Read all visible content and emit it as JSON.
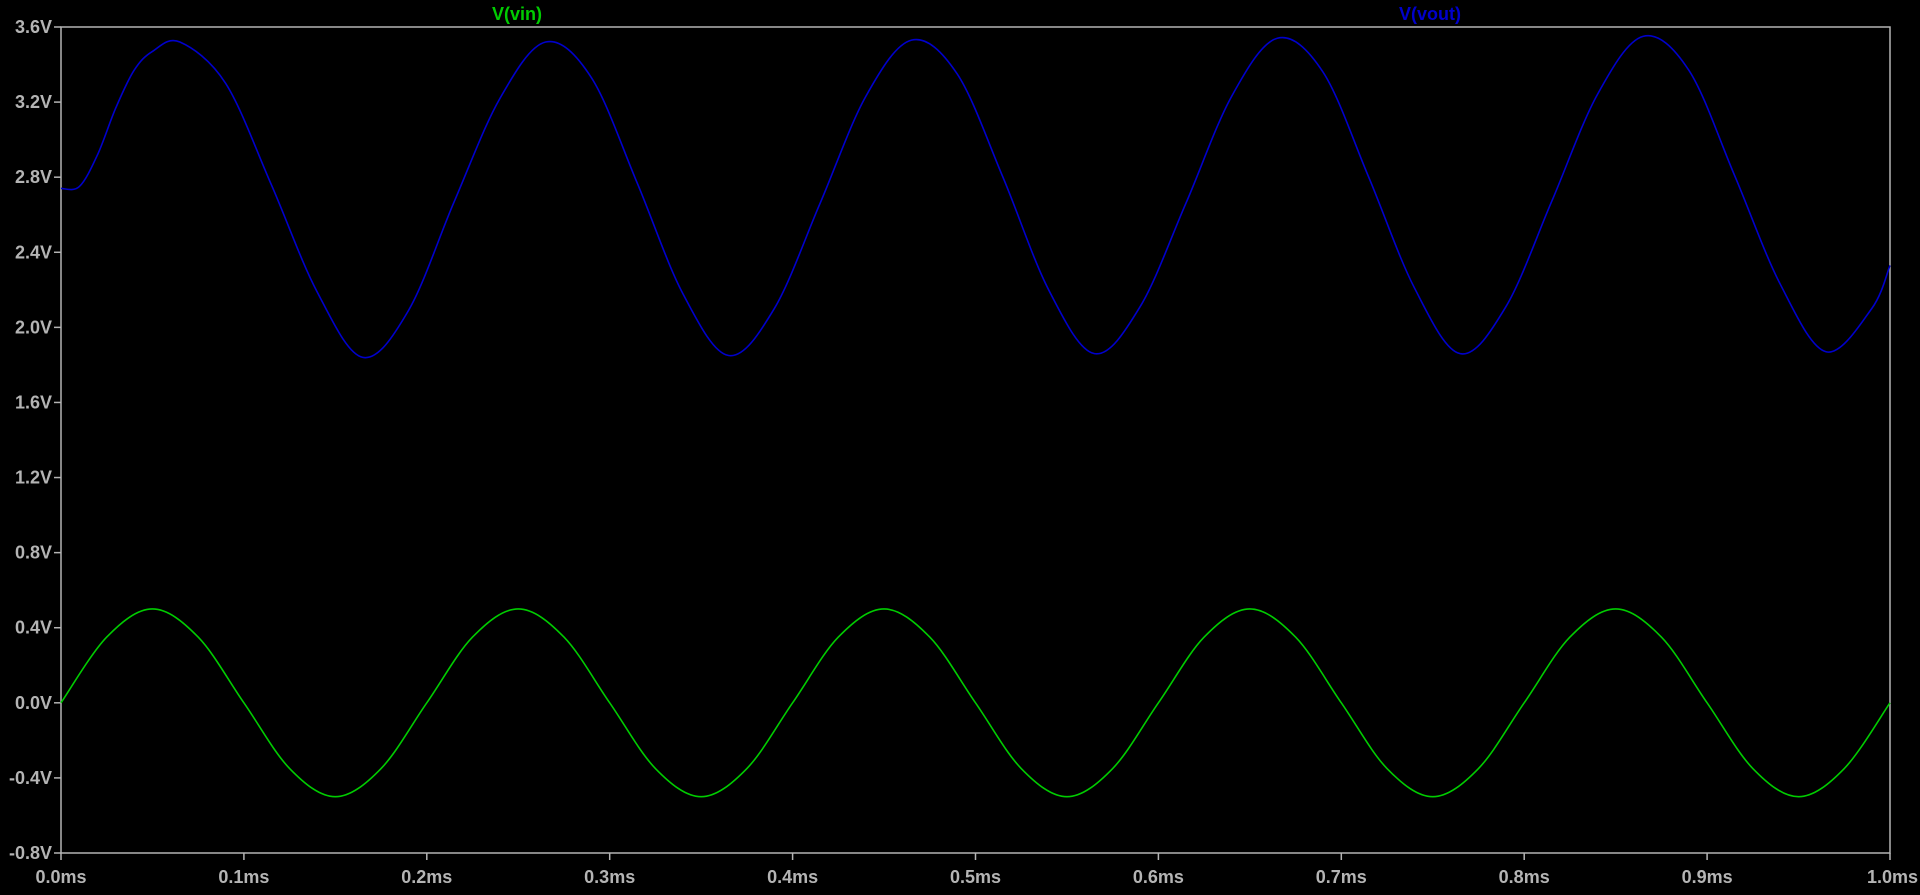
{
  "traces": {
    "vin": {
      "label": "V(vin)",
      "color": "#00cc00"
    },
    "vout": {
      "label": "V(vout)",
      "color": "#0000cc"
    }
  },
  "colors": {
    "background": "#000000",
    "frame": "#b4b4b4",
    "tick_label": "#b4b4b4"
  },
  "chart_data": {
    "type": "line",
    "x_unit": "ms",
    "y_unit": "V",
    "xlim": [
      0.0,
      1.0
    ],
    "ylim": [
      -0.8,
      3.6
    ],
    "grid": false,
    "x_ticks": [
      {
        "value": 0.0,
        "label": "0.0ms"
      },
      {
        "value": 0.1,
        "label": "0.1ms"
      },
      {
        "value": 0.2,
        "label": "0.2ms"
      },
      {
        "value": 0.3,
        "label": "0.3ms"
      },
      {
        "value": 0.4,
        "label": "0.4ms"
      },
      {
        "value": 0.5,
        "label": "0.5ms"
      },
      {
        "value": 0.6,
        "label": "0.6ms"
      },
      {
        "value": 0.7,
        "label": "0.7ms"
      },
      {
        "value": 0.8,
        "label": "0.8ms"
      },
      {
        "value": 0.9,
        "label": "0.9ms"
      },
      {
        "value": 1.0,
        "label": "1.0ms"
      }
    ],
    "y_ticks": [
      {
        "value": 3.6,
        "label": "3.6V"
      },
      {
        "value": 3.2,
        "label": "3.2V"
      },
      {
        "value": 2.8,
        "label": "2.8V"
      },
      {
        "value": 2.4,
        "label": "2.4V"
      },
      {
        "value": 2.0,
        "label": "2.0V"
      },
      {
        "value": 1.6,
        "label": "1.6V"
      },
      {
        "value": 1.2,
        "label": "1.2V"
      },
      {
        "value": 0.8,
        "label": "0.8V"
      },
      {
        "value": 0.4,
        "label": "0.4V"
      },
      {
        "value": 0.0,
        "label": "0.0V"
      },
      {
        "value": -0.4,
        "label": "-0.4V"
      },
      {
        "value": -0.8,
        "label": "-0.8V"
      }
    ],
    "series": [
      {
        "name": "V(vin)",
        "color": "#00cc00",
        "x": [
          0.0,
          0.025,
          0.05,
          0.075,
          0.1,
          0.125,
          0.15,
          0.175,
          0.2,
          0.225,
          0.25,
          0.275,
          0.3,
          0.325,
          0.35,
          0.375,
          0.4,
          0.425,
          0.45,
          0.475,
          0.5,
          0.525,
          0.55,
          0.575,
          0.6,
          0.625,
          0.65,
          0.675,
          0.7,
          0.725,
          0.75,
          0.775,
          0.8,
          0.825,
          0.85,
          0.875,
          0.9,
          0.925,
          0.95,
          0.975,
          1.0
        ],
        "y": [
          0.0,
          0.35,
          0.5,
          0.35,
          0.0,
          -0.35,
          -0.5,
          -0.35,
          0.0,
          0.35,
          0.5,
          0.35,
          0.0,
          -0.35,
          -0.5,
          -0.35,
          0.0,
          0.35,
          0.5,
          0.35,
          0.0,
          -0.35,
          -0.5,
          -0.35,
          0.0,
          0.35,
          0.5,
          0.35,
          0.0,
          -0.35,
          -0.5,
          -0.35,
          0.0,
          0.35,
          0.5,
          0.35,
          0.0,
          -0.35,
          -0.5,
          -0.35,
          0.0
        ]
      },
      {
        "name": "V(vout)",
        "color": "#0000cc",
        "x": [
          0.0,
          0.01,
          0.02,
          0.03,
          0.04,
          0.05,
          0.065,
          0.09,
          0.115,
          0.14,
          0.165,
          0.19,
          0.215,
          0.24,
          0.265,
          0.29,
          0.315,
          0.34,
          0.365,
          0.39,
          0.415,
          0.44,
          0.465,
          0.49,
          0.515,
          0.54,
          0.565,
          0.59,
          0.615,
          0.64,
          0.665,
          0.69,
          0.715,
          0.74,
          0.765,
          0.79,
          0.815,
          0.84,
          0.865,
          0.89,
          0.915,
          0.94,
          0.965,
          0.99,
          1.0
        ],
        "y": [
          2.74,
          2.75,
          2.92,
          3.17,
          3.37,
          3.47,
          3.52,
          3.3,
          2.76,
          2.19,
          1.84,
          2.09,
          2.67,
          3.22,
          3.52,
          3.33,
          2.77,
          2.18,
          1.85,
          2.1,
          2.66,
          3.23,
          3.53,
          3.35,
          2.8,
          2.2,
          1.86,
          2.11,
          2.66,
          3.23,
          3.54,
          3.36,
          2.8,
          2.21,
          1.86,
          2.11,
          2.67,
          3.24,
          3.55,
          3.37,
          2.81,
          2.23,
          1.87,
          2.1,
          2.33
        ]
      }
    ]
  }
}
